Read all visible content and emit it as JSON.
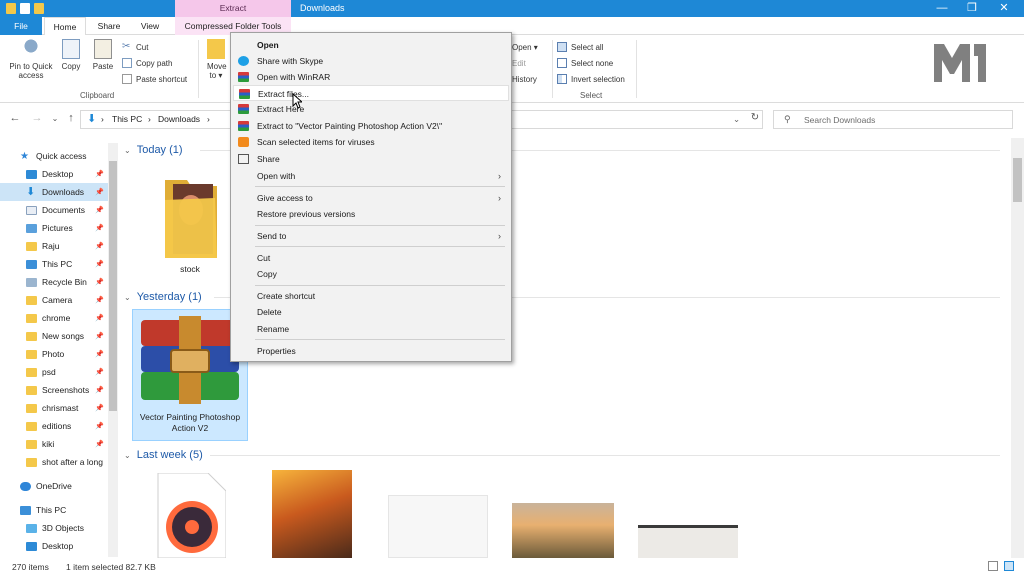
{
  "colors": {
    "accent": "#1e88d6",
    "context_tab": "#f5c7ea",
    "selection": "#cce4f7",
    "folder": "#f4c84a",
    "link": "#1e5aa8"
  },
  "titlebar": {
    "context_tab_header": "Extract",
    "window_title": "Downloads",
    "minimize": "—",
    "maximize": "❐",
    "close": "✕"
  },
  "tabs": {
    "file": "File",
    "home": "Home",
    "share": "Share",
    "view": "View",
    "compressed": "Compressed Folder Tools"
  },
  "ribbon": {
    "pin": "Pin to Quick access",
    "copy": "Copy",
    "paste": "Paste",
    "cut": "Cut",
    "copy_path": "Copy path",
    "paste_shortcut": "Paste shortcut",
    "clipboard_group": "Clipboard",
    "move_to": "Move to ▾",
    "open": "Open ▾",
    "edit": "Edit",
    "history": "History",
    "select_all": "Select all",
    "select_none": "Select none",
    "invert_selection": "Invert selection",
    "select_group": "Select"
  },
  "address": {
    "this_pc": "This PC",
    "sep": "›",
    "downloads": "Downloads",
    "search_placeholder": "Search Downloads"
  },
  "nav": {
    "items": [
      {
        "label": "Quick access",
        "icon": "star-icon"
      },
      {
        "label": "Desktop",
        "icon": "desktop-icon"
      },
      {
        "label": "Downloads",
        "icon": "download-icon"
      },
      {
        "label": "Documents",
        "icon": "document-icon"
      },
      {
        "label": "Pictures",
        "icon": "pictures-icon"
      },
      {
        "label": "Raju",
        "icon": "folder-icon"
      },
      {
        "label": "This PC",
        "icon": "computer-icon"
      },
      {
        "label": "Recycle Bin",
        "icon": "recycle-bin-icon"
      },
      {
        "label": "Camera",
        "icon": "folder-icon"
      },
      {
        "label": "chrome",
        "icon": "folder-icon"
      },
      {
        "label": "New songs",
        "icon": "folder-icon"
      },
      {
        "label": "Photo",
        "icon": "folder-icon"
      },
      {
        "label": "psd",
        "icon": "folder-icon"
      },
      {
        "label": "Screenshots",
        "icon": "folder-icon"
      },
      {
        "label": "chrismast",
        "icon": "folder-icon"
      },
      {
        "label": "editions",
        "icon": "folder-icon"
      },
      {
        "label": "kiki",
        "icon": "folder-icon"
      },
      {
        "label": "shot after a long",
        "icon": "folder-icon"
      },
      {
        "label": "OneDrive",
        "icon": "cloud-icon"
      },
      {
        "label": "This PC",
        "icon": "computer-icon"
      },
      {
        "label": "3D Objects",
        "icon": "cube-icon"
      },
      {
        "label": "Desktop",
        "icon": "desktop-icon"
      }
    ]
  },
  "content": {
    "groups": {
      "today": "Today (1)",
      "yesterday": "Yesterday (1)",
      "last_week": "Last week (5)"
    },
    "files": {
      "stock": "stock",
      "rar": "Vector Painting Photoshop Action V2"
    }
  },
  "context_menu": {
    "open": "Open",
    "skype": "Share with Skype",
    "winrar": "Open with WinRAR",
    "extract_files": "Extract files...",
    "extract_here": "Extract Here",
    "extract_to": "Extract to \"Vector Painting Photoshop Action V2\\\"",
    "scan": "Scan selected items for viruses",
    "share": "Share",
    "open_with": "Open with",
    "give_access": "Give access to",
    "restore": "Restore previous versions",
    "send_to": "Send to",
    "cut": "Cut",
    "copy": "Copy",
    "create_shortcut": "Create shortcut",
    "delete": "Delete",
    "rename": "Rename",
    "properties": "Properties"
  },
  "status": {
    "items": "270 items",
    "selected": "1 item selected  82.7 KB"
  }
}
